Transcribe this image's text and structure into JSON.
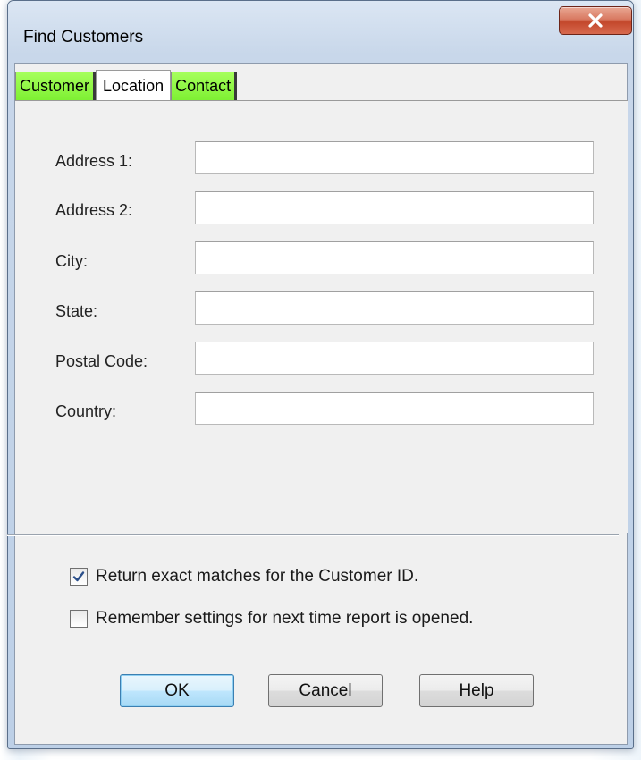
{
  "window": {
    "title": "Find Customers"
  },
  "tabs": [
    {
      "label": "Customer",
      "active": false
    },
    {
      "label": "Location",
      "active": true
    },
    {
      "label": "Contact",
      "active": false
    }
  ],
  "fields": {
    "address1": {
      "label": "Address 1:",
      "value": ""
    },
    "address2": {
      "label": "Address 2:",
      "value": ""
    },
    "city": {
      "label": "City:",
      "value": ""
    },
    "state": {
      "label": "State:",
      "value": ""
    },
    "postal_code": {
      "label": "Postal Code:",
      "value": ""
    },
    "country": {
      "label": "Country:",
      "value": ""
    }
  },
  "options": {
    "exact_match": {
      "label": "Return exact matches for the Customer ID.",
      "checked": true
    },
    "remember": {
      "label": "Remember settings for next time report is opened.",
      "checked": false
    }
  },
  "buttons": {
    "ok": "OK",
    "cancel": "Cancel",
    "help": "Help"
  },
  "colors": {
    "inactive_tab": "#7ef033",
    "close_button": "#c3472b",
    "default_button_border": "#3c7fb1"
  }
}
